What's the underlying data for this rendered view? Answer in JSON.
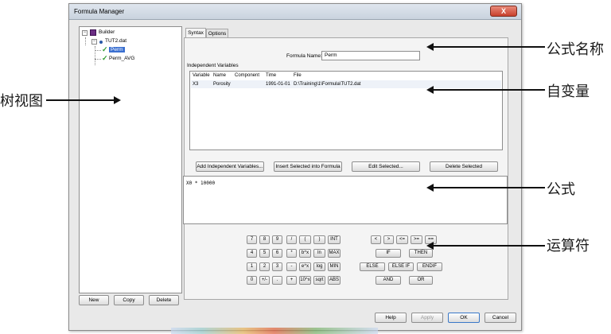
{
  "window": {
    "title": "Formula Manager",
    "close_label": "X"
  },
  "tree": {
    "items": [
      {
        "label": "Builder",
        "expander": "−"
      },
      {
        "label": "TUT2.dat",
        "expander": "−"
      },
      {
        "label": "Perm"
      },
      {
        "label": "Perm_AVG"
      }
    ]
  },
  "left_buttons": {
    "new": "New",
    "copy": "Copy",
    "delete": "Delete"
  },
  "tabs": [
    "Syntax",
    "Options"
  ],
  "formula_name": {
    "label": "Formula Name:",
    "value": "Perm"
  },
  "independent_variables": {
    "group_label": "Independent Variables",
    "columns": [
      "Variable",
      "Name",
      "Component",
      "Time",
      "File"
    ],
    "rows": [
      [
        "X3",
        "Porosity",
        "",
        "1991-01-01",
        "D:\\Training\\1\\Formula\\TUT2.dat"
      ]
    ]
  },
  "var_buttons": {
    "add": "Add Independent Variables...",
    "insert": "Insert Selected into Formula",
    "edit": "Edit Selected...",
    "delete": "Delete Selected"
  },
  "formula_text": "X0 * 10000",
  "keypad": {
    "row1": [
      "7",
      "8",
      "9",
      "/",
      "(",
      ")",
      "INT"
    ],
    "row2": [
      "4",
      "5",
      "6",
      "*",
      "b^x",
      "ln",
      "MAX"
    ],
    "row3": [
      "1",
      "2",
      "3",
      "-",
      "e^x",
      "log",
      "MIN"
    ],
    "row4": [
      "0",
      "+/-",
      ".",
      "+",
      "10^x",
      "sqrt",
      "ABS"
    ]
  },
  "operators": {
    "row1": [
      "<",
      ">",
      "<=",
      ">=",
      "=="
    ],
    "row2": [
      "IF",
      "THEN"
    ],
    "row3": [
      "ELSE",
      "ELSE IF",
      "ENDIF"
    ],
    "row4": [
      "AND",
      "OR"
    ]
  },
  "dialog_buttons": {
    "help": "Help",
    "apply": "Apply",
    "ok": "OK",
    "cancel": "Cancel"
  },
  "annotations": {
    "tree_view": "树视图",
    "formula_name": "公式名称",
    "variables": "自变量",
    "formula": "公式",
    "operators": "运算符"
  }
}
